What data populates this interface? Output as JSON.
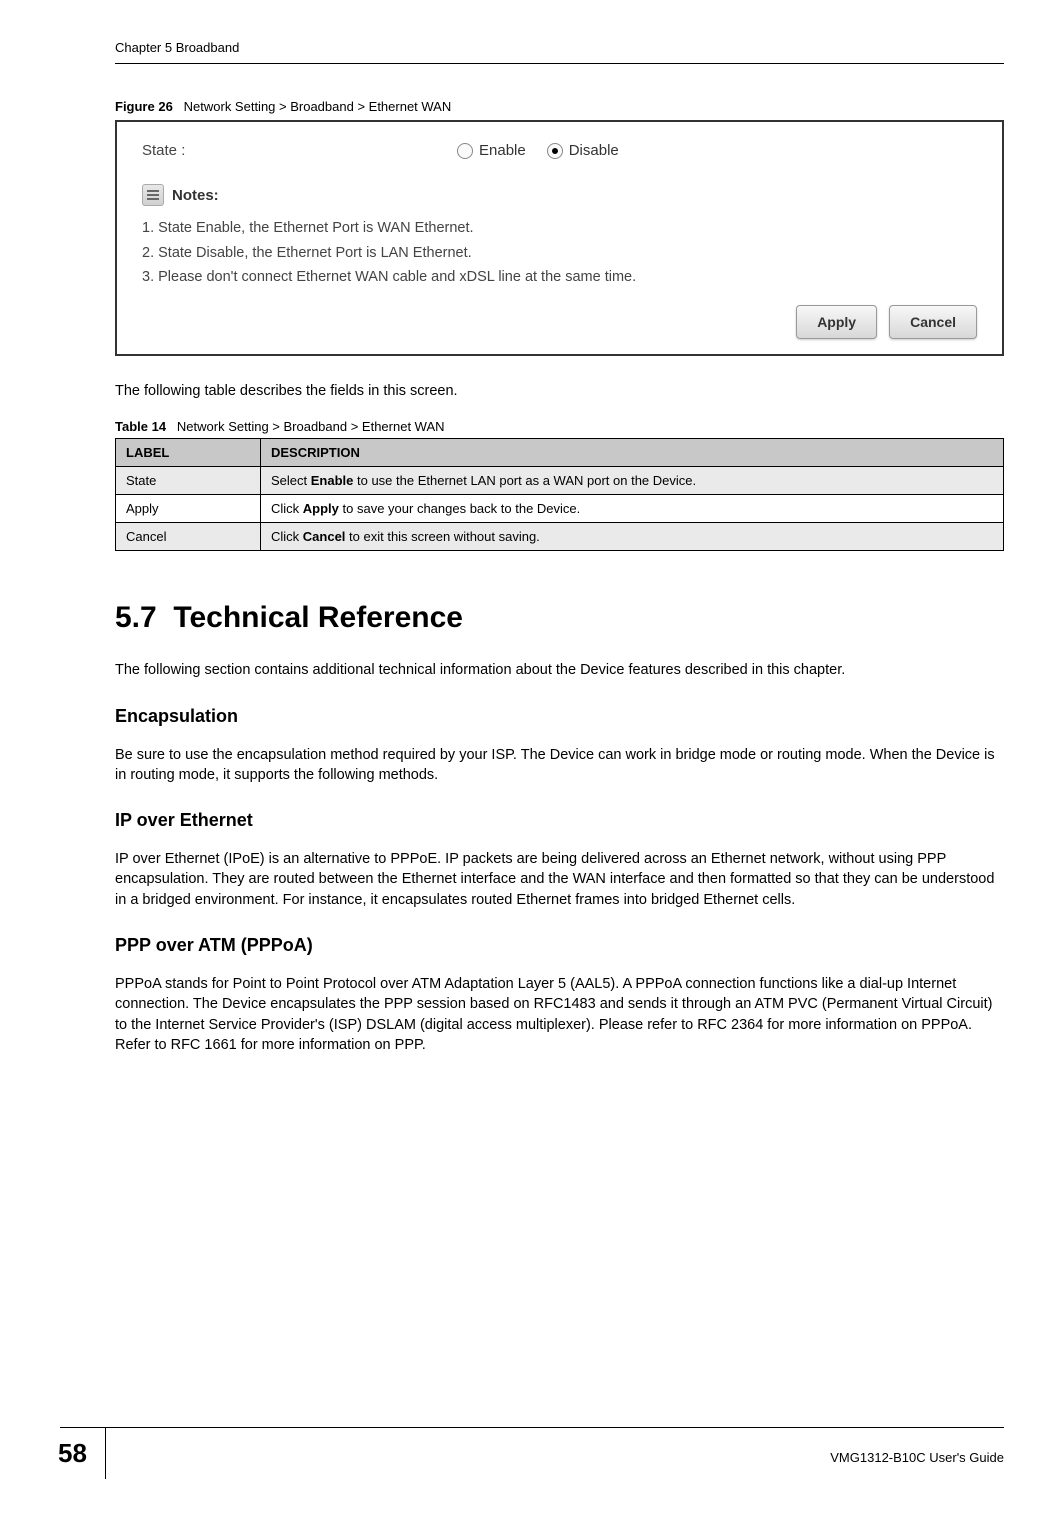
{
  "chapter_header": "Chapter 5 Broadband",
  "figure": {
    "number": "Figure 26",
    "title": "Network Setting > Broadband > Ethernet WAN"
  },
  "screenshot": {
    "state_label": "State :",
    "radio_enable": "Enable",
    "radio_disable": "Disable",
    "notes_title": "Notes:",
    "notes": [
      "1. State Enable, the Ethernet Port is WAN Ethernet.",
      "2. State Disable, the Ethernet Port is LAN Ethernet.",
      "3. Please don't connect Ethernet WAN cable and xDSL line at the same time."
    ],
    "apply_button": "Apply",
    "cancel_button": "Cancel"
  },
  "intro_text": "The following table describes the fields in this screen.",
  "table": {
    "number": "Table 14",
    "title": "Network Setting > Broadband > Ethernet WAN",
    "headers": [
      "LABEL",
      "DESCRIPTION"
    ],
    "rows": [
      {
        "label": "State",
        "desc_prefix": "Select ",
        "desc_bold": "Enable",
        "desc_suffix": " to use the Ethernet LAN port as a WAN port on the Device."
      },
      {
        "label": "Apply",
        "desc_prefix": "Click ",
        "desc_bold": "Apply",
        "desc_suffix": " to save your changes back to the Device."
      },
      {
        "label": "Cancel",
        "desc_prefix": "Click ",
        "desc_bold": "Cancel",
        "desc_suffix": " to exit this screen without saving."
      }
    ]
  },
  "section": {
    "number": "5.7",
    "title": "Technical Reference",
    "intro": "The following section contains additional technical information about the Device features described in this chapter."
  },
  "encapsulation": {
    "heading": "Encapsulation",
    "text": "Be sure to use the encapsulation method required by your ISP. The Device can work in bridge mode or routing mode. When the Device is in routing mode, it supports the following methods."
  },
  "ipoe": {
    "heading": "IP over Ethernet",
    "text": "IP over Ethernet (IPoE) is an alternative to PPPoE. IP packets are being delivered across an Ethernet network, without using PPP encapsulation. They are routed between the Ethernet interface and the WAN interface and then formatted so that they can be understood in a bridged environment. For instance, it encapsulates routed Ethernet frames into bridged Ethernet cells."
  },
  "pppoa": {
    "heading": "PPP over ATM (PPPoA)",
    "text": "PPPoA stands for Point to Point Protocol over ATM Adaptation Layer 5 (AAL5). A PPPoA connection functions like a dial-up Internet connection. The Device encapsulates the PPP session based on RFC1483 and sends it through an ATM PVC (Permanent Virtual Circuit) to the Internet Service Provider's (ISP) DSLAM (digital access multiplexer). Please refer to RFC 2364 for more information on PPPoA. Refer to RFC 1661 for more information on PPP."
  },
  "footer": {
    "page_number": "58",
    "guide_name": "VMG1312-B10C User's Guide"
  }
}
